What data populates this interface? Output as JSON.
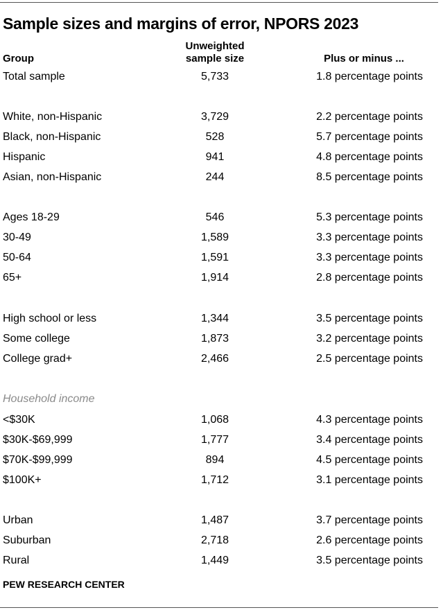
{
  "title": "Sample sizes and margins of error, NPORS 2023",
  "headers": {
    "group": "Group",
    "sample_line1": "Unweighted",
    "sample_line2": "sample size",
    "moe": "Plus or minus ..."
  },
  "rows": [
    {
      "group": "Total sample",
      "n": "5,733",
      "moe": "1.8 percentage points"
    },
    {
      "group": "White, non-Hispanic",
      "n": "3,729",
      "moe": "2.2 percentage points"
    },
    {
      "group": "Black, non-Hispanic",
      "n": "528",
      "moe": "5.7 percentage points"
    },
    {
      "group": "Hispanic",
      "n": "941",
      "moe": "4.8 percentage points"
    },
    {
      "group": "Asian, non-Hispanic",
      "n": "244",
      "moe": "8.5 percentage points"
    },
    {
      "group": "Ages 18-29",
      "n": "546",
      "moe": "5.3 percentage points"
    },
    {
      "group": "30-49",
      "n": "1,589",
      "moe": "3.3 percentage points"
    },
    {
      "group": "50-64",
      "n": "1,591",
      "moe": "3.3 percentage points"
    },
    {
      "group": "65+",
      "n": "1,914",
      "moe": "2.8 percentage points"
    },
    {
      "group": "High school or less",
      "n": "1,344",
      "moe": "3.5 percentage points"
    },
    {
      "group": "Some college",
      "n": "1,873",
      "moe": "3.2 percentage points"
    },
    {
      "group": "College grad+",
      "n": "2,466",
      "moe": "2.5 percentage points"
    },
    {
      "group": "<$30K",
      "n": "1,068",
      "moe": "4.3 percentage points"
    },
    {
      "group": "$30K-$69,999",
      "n": "1,777",
      "moe": "3.4 percentage points"
    },
    {
      "group": "$70K-$99,999",
      "n": "894",
      "moe": "4.5 percentage points"
    },
    {
      "group": "$100K+",
      "n": "1,712",
      "moe": "3.1 percentage points"
    },
    {
      "group": "Urban",
      "n": "1,487",
      "moe": "3.7 percentage points"
    },
    {
      "group": "Suburban",
      "n": "2,718",
      "moe": "2.6 percentage points"
    },
    {
      "group": "Rural",
      "n": "1,449",
      "moe": "3.5 percentage points"
    }
  ],
  "section_label_income": "Household income",
  "footer": "PEW RESEARCH CENTER"
}
